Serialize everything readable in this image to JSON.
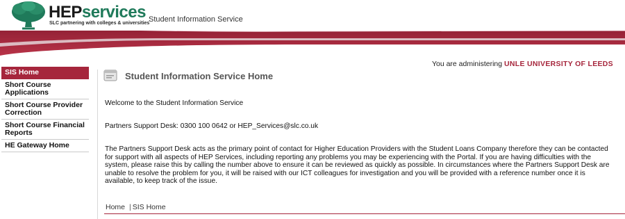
{
  "header": {
    "logo_hep": "HEP",
    "logo_services": "services",
    "logo_tagline": "SLC partnering with colleges & universities",
    "site_name": "Student Information Service"
  },
  "colors": {
    "brand_red": "#a6263c",
    "logo_green": "#1f7a5a"
  },
  "sidebar": {
    "items": [
      {
        "label": "SIS Home",
        "active": true
      },
      {
        "label": "Short Course Applications",
        "active": false
      },
      {
        "label": "Short Course Provider Correction",
        "active": false
      },
      {
        "label": "Short Course Financial Reports",
        "active": false
      },
      {
        "label": "HE Gateway Home",
        "active": false
      }
    ]
  },
  "main": {
    "admin_prefix": "You are administering",
    "admin_org": "UNLE UNIVERSITY OF LEEDS",
    "page_title": "Student Information Service Home",
    "welcome": "Welcome to the Student Information Service",
    "support_desk": "Partners Support Desk: 0300 100 0642 or HEP_Services@slc.co.uk",
    "description": "The Partners Support Desk acts as the primary point of contact for Higher Education Providers with the Student Loans Company therefore they can be contacted for support with all aspects of HEP Services, including reporting any problems you may be experiencing with the Portal. If you are having difficulties with the system, please raise this by calling the number above to ensure it can be reviewed as quickly as possible. In circumstances where the Partners Support Desk are unable to resolve the problem for you, it will be raised with our ICT colleagues for investigation and you will be provided with a reference number once it is available, to keep track of the issue."
  },
  "breadcrumb": {
    "home": "Home",
    "separator": "|",
    "current": "SIS Home"
  },
  "icons": {
    "logo": "tree-logo-icon",
    "page": "document-icon"
  }
}
